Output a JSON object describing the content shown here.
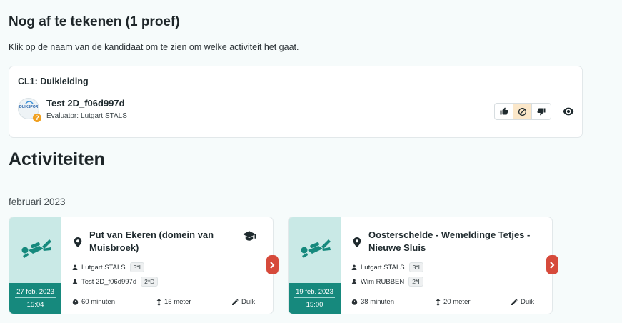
{
  "pending": {
    "title": "Nog af te tekenen (1 proef)",
    "instruction": "Klik op de naam van de kandidaat om te zien om welke activiteit het gaat.",
    "card": {
      "title": "CL1: Duikleiding",
      "avatar_text": "DUIKSPORT",
      "badge": "?",
      "candidate": "Test 2D_f06d997d",
      "evaluator_label": "Evaluator:",
      "evaluator": "Lutgart STALS",
      "actions": [
        "thumbs-up-icon",
        "ban-icon",
        "thumbs-down-icon"
      ],
      "active_action": "ban-icon",
      "accent": "#fbe7c9"
    }
  },
  "activities": {
    "title": "Activiteiten",
    "month": "februari 2023",
    "items": [
      {
        "title": "Put van Ekeren (domein van Muisbroek)",
        "date": "27 feb. 2023",
        "time": "15:04",
        "people": [
          {
            "name": "Lutgart STALS",
            "level": "3*I"
          },
          {
            "name": "Test 2D_f06d997d",
            "level": "2*D"
          }
        ],
        "duration": "60 minuten",
        "depth": "15 meter",
        "type": "Duik",
        "has_cap_icon": true
      },
      {
        "title": "Oosterschelde - Wemeldinge Tetjes - Nieuwe Sluis",
        "date": "19 feb. 2023",
        "time": "15:00",
        "people": [
          {
            "name": "Lutgart STALS",
            "level": "3*I"
          },
          {
            "name": "Wim RUBBEN",
            "level": "2*I"
          }
        ],
        "duration": "38 minuten",
        "depth": "20 meter",
        "type": "Duik",
        "has_cap_icon": false
      }
    ]
  },
  "colors": {
    "teal": "#16897d",
    "teal_light": "#c9e9e6",
    "arrow": "#d64a3b",
    "warning": "#f0a020"
  }
}
